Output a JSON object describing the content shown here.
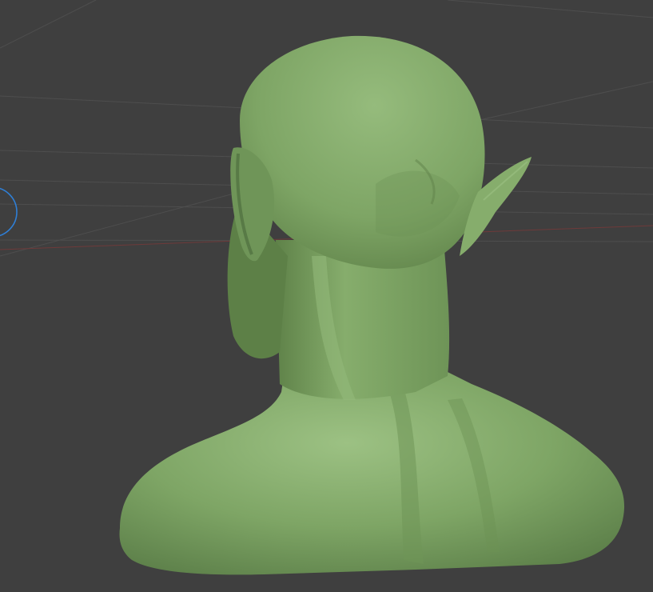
{
  "viewport": {
    "background_color": "#3f3f3f",
    "grid_color": "#4e4e4e",
    "x_axis_color": "#7a3b3b",
    "model_color": "#7ea565",
    "model_shadow_color": "#4f6f3e",
    "model_highlight_color": "#9cc183",
    "brush_cursor_color": "#2f7fd6",
    "icons": {
      "brush_cursor": "circle-brush-cursor-icon"
    }
  }
}
